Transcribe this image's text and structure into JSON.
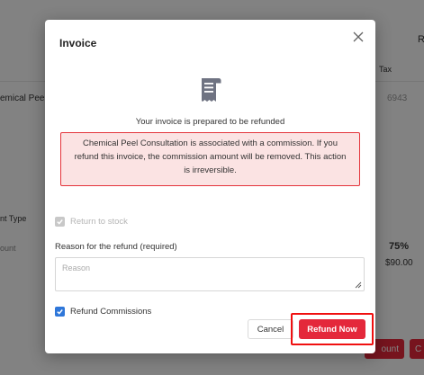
{
  "background": {
    "tax_header": "Tax",
    "column_header_r": "R",
    "service_partial": "emical Peel C",
    "tax_value": "6943",
    "type_label": "nt Type",
    "amount_label": "ount",
    "percent": "75%",
    "price": "$90.00",
    "button_partial": "ount",
    "button_partial_2": "C"
  },
  "modal": {
    "title": "Invoice",
    "icon": "receipt-icon",
    "prepared_text": "Your invoice is prepared to be refunded",
    "warning_text": "Chemical Peel Consultation is associated with a commission. If you refund this invoice, the commission amount will be removed. This action is irreversible.",
    "return_to_stock_label": "Return to stock",
    "return_to_stock_checked": true,
    "reason_label": "Reason for the refund (required)",
    "reason_placeholder": "Reason",
    "reason_value": "",
    "refund_commissions_label": "Refund Commissions",
    "refund_commissions_checked": true,
    "cancel_label": "Cancel",
    "refund_label": "Refund Now"
  },
  "colors": {
    "primary_red": "#e4283b",
    "warning_border": "#e4333a",
    "warning_bg": "#fbe3e3",
    "checkbox_blue": "#2f77d9",
    "highlight_red": "#f01010"
  }
}
